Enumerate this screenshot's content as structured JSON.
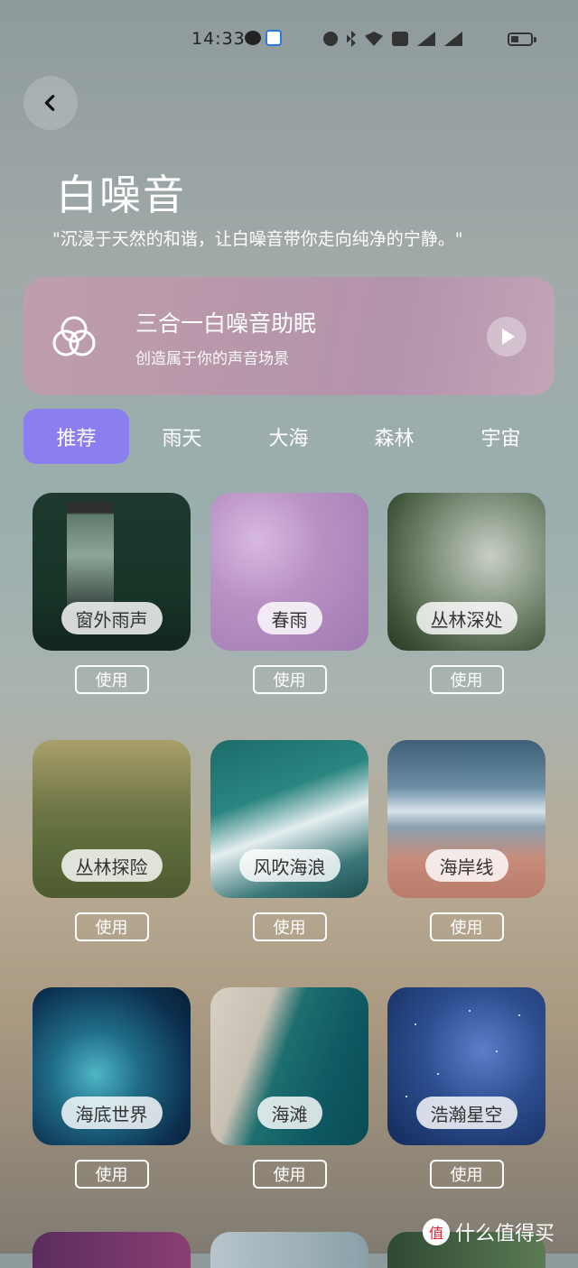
{
  "status_bar": {
    "time": "14:33",
    "battery_icon": "battery-icon"
  },
  "header": {
    "title": "白噪音",
    "subtitle": "\"沉浸于天然的和谐，让白噪音带你走向纯净的宁静。\""
  },
  "banner": {
    "title": "三合一白噪音助眠",
    "subtitle": "创造属于你的声音场景"
  },
  "tabs": [
    {
      "label": "推荐",
      "active": true
    },
    {
      "label": "雨天",
      "active": false
    },
    {
      "label": "大海",
      "active": false
    },
    {
      "label": "森林",
      "active": false
    },
    {
      "label": "宇宙",
      "active": false
    }
  ],
  "sounds": [
    {
      "name": "窗外雨声",
      "action": "使用"
    },
    {
      "name": "春雨",
      "action": "使用"
    },
    {
      "name": "丛林深处",
      "action": "使用"
    },
    {
      "name": "丛林探险",
      "action": "使用"
    },
    {
      "name": "风吹海浪",
      "action": "使用"
    },
    {
      "name": "海岸线",
      "action": "使用"
    },
    {
      "name": "海底世界",
      "action": "使用"
    },
    {
      "name": "海滩",
      "action": "使用"
    },
    {
      "name": "浩瀚星空",
      "action": "使用"
    }
  ],
  "watermark": {
    "text": "什么值得买",
    "icon_text": "值"
  },
  "colors": {
    "accent": "#8b7ef0"
  }
}
